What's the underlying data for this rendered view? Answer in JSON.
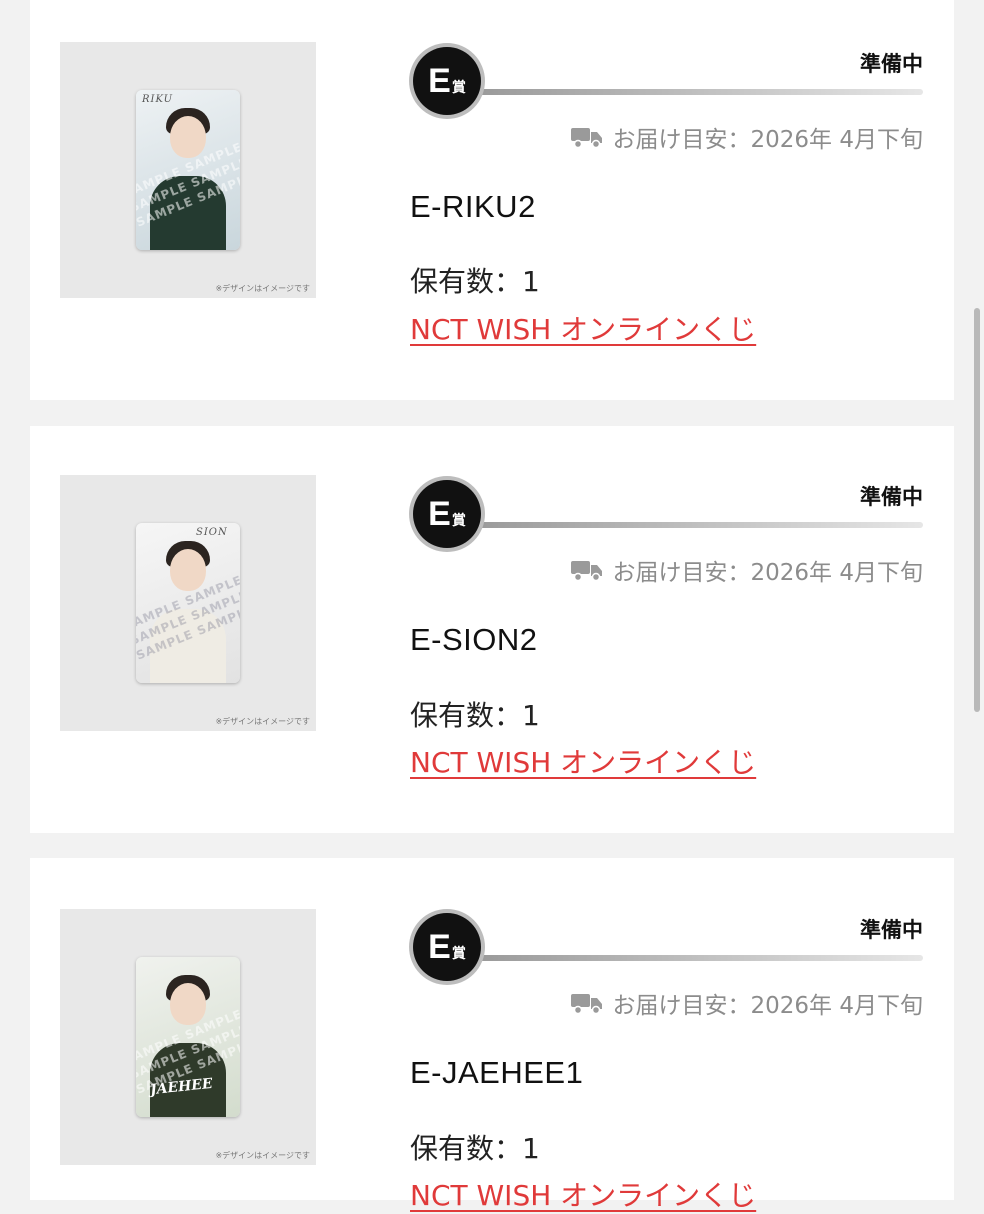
{
  "colors": {
    "page_bg": "#f2f2f2",
    "link": "#e03a3a",
    "muted": "#8c8c8c",
    "badge": "#111111"
  },
  "items": [
    {
      "badge_letter": "E",
      "badge_suffix": "賞",
      "status": "準備中",
      "delivery": "お届け目安：2026年 4月下旬",
      "name": "E-RIKU2",
      "quantity": "保有数：1",
      "link": "NCT WISH オンラインくじ",
      "image_caption": "※デザインはイメージです",
      "card_name": "RIKU"
    },
    {
      "badge_letter": "E",
      "badge_suffix": "賞",
      "status": "準備中",
      "delivery": "お届け目安：2026年 4月下旬",
      "name": "E-SION2",
      "quantity": "保有数：1",
      "link": "NCT WISH オンラインくじ",
      "image_caption": "※デザインはイメージです",
      "card_name": "SION"
    },
    {
      "badge_letter": "E",
      "badge_suffix": "賞",
      "status": "準備中",
      "delivery": "お届け目安：2026年 4月下旬",
      "name": "E-JAEHEE1",
      "quantity": "保有数：1",
      "link": "NCT WISH オンラインくじ",
      "image_caption": "※デザインはイメージです",
      "card_name": "JAEHEE"
    }
  ],
  "icons": {
    "delivery": "truck-icon",
    "prize": "prize-badge-icon"
  }
}
